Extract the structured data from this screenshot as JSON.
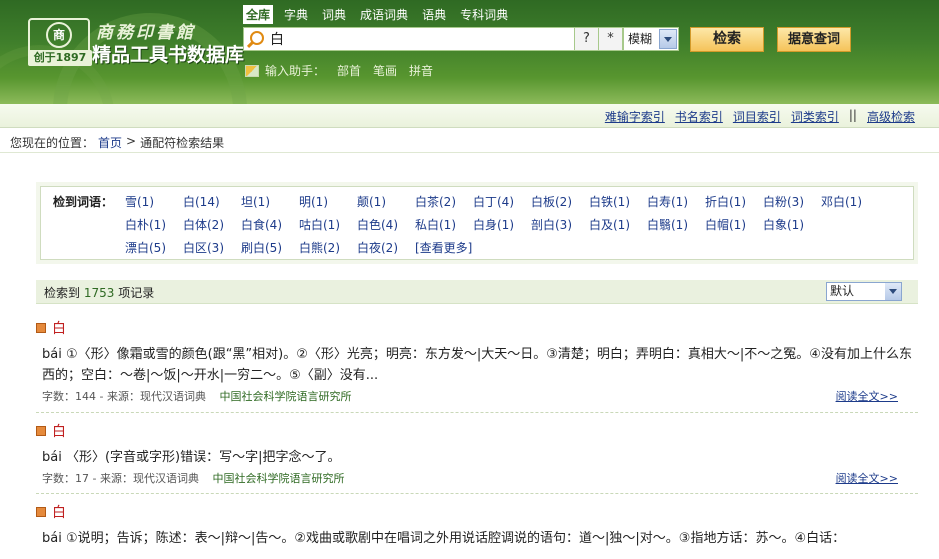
{
  "logo": {
    "emblem": "商",
    "founded": "创于1897",
    "brand_top": "商務印書館",
    "brand_main": "精品工具书数据库"
  },
  "nav_tabs": [
    "全库",
    "字典",
    "词典",
    "成语词典",
    "语典",
    "专科词典"
  ],
  "search": {
    "value": "白",
    "wildcard_q": "?",
    "wildcard_star": "*",
    "mode": "模糊",
    "search_label": "检索",
    "fuzzy_label": "据意查词"
  },
  "helper": {
    "label": "输入助手：",
    "links": [
      "部首",
      "笔画",
      "拼音"
    ]
  },
  "index_links": [
    "难输字索引",
    "书名索引",
    "词目索引",
    "词类索引"
  ],
  "index_sep": "||",
  "advanced_link": "高级检索",
  "breadcrumb": {
    "prefix": "您现在的位置：",
    "home": "首页",
    "sep": ">",
    "current": "通配符检索结果"
  },
  "words": {
    "label": "检到词语：",
    "rows": [
      [
        "雪(1)",
        "白(14)",
        "坦(1)",
        "明(1)",
        "颠(1)",
        "白茶(2)",
        "白丁(4)",
        "白板(2)",
        "白铁(1)",
        "白寿(1)",
        "折白(1)",
        "白粉(3)",
        "邓白(1)"
      ],
      [
        "白朴(1)",
        "白体(2)",
        "白食(4)",
        "咕白(1)",
        "白色(4)",
        "私白(1)",
        "白身(1)",
        "剖白(3)",
        "白及(1)",
        "白翳(1)",
        "白帽(1)",
        "白象(1)"
      ],
      [
        "漂白(5)",
        "白区(3)",
        "刷白(5)",
        "白熊(2)",
        "白夜(2)"
      ]
    ],
    "more": "[查看更多]"
  },
  "records": {
    "prefix": "检索到",
    "count": "1753",
    "suffix": "项记录",
    "sort": "默认"
  },
  "results": [
    {
      "title": "白",
      "body": "bái ①〈形〉像霜或雪的颜色(跟“黑”相对)。②〈形〉光亮；明亮：东方发～|大天～日。③清楚；明白；弄明白：真相大～|不～之冤。④没有加上什么东西的；空白：～卷|～饭|～开水|一穷二～。⑤〈副〉没有...",
      "meta": "字数：144 - 来源：现代汉语词典",
      "org": "中国社会科学院语言研究所",
      "read_more": "阅读全文>>"
    },
    {
      "title": "白",
      "body": "bái 〈形〉(字音或字形)错误：写～字|把字念～了。",
      "meta": "字数：17 - 来源：现代汉语词典",
      "org": "中国社会科学院语言研究所",
      "read_more": "阅读全文>>"
    },
    {
      "title": "白",
      "body": "bái ①说明；告诉；陈述：表～|辩～|告～。②戏曲或歌剧中在唱词之外用说话腔调说的语句：道～|独～|对～。③指地方话：苏～。④白话："
    }
  ]
}
